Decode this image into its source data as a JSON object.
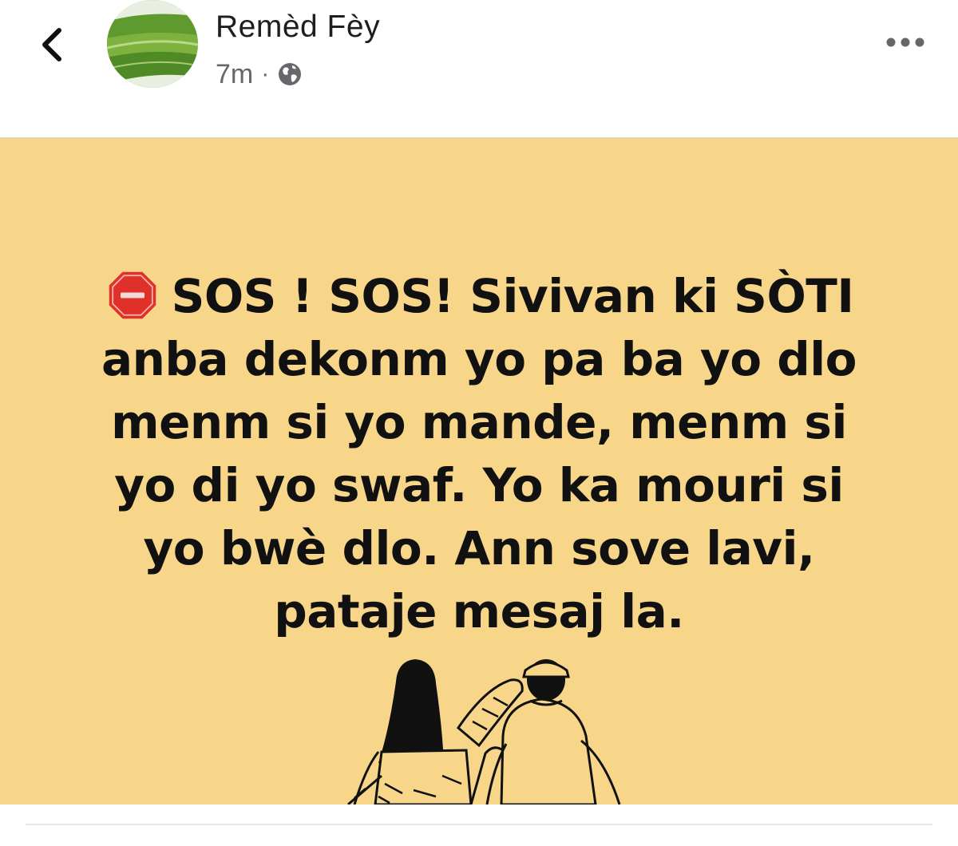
{
  "header": {
    "page_name": "Remèd Fèy",
    "timestamp": "7m",
    "separator": "·",
    "privacy_icon": "globe-icon",
    "back_icon": "chevron-left-icon",
    "more_icon": "more-horizontal-icon"
  },
  "post": {
    "background_color": "#F7D68A",
    "emoji": "stop-sign-icon",
    "lines": [
      "SOS ! SOS! Sivivan ki SÒTI",
      "anba dekonm yo pa ba yo dlo",
      "menm si yo mande, menm si",
      "yo di yo swaf. Yo ka mouri si",
      "yo bwè dlo. Ann sove lavi,",
      "pataje mesaj la."
    ]
  }
}
